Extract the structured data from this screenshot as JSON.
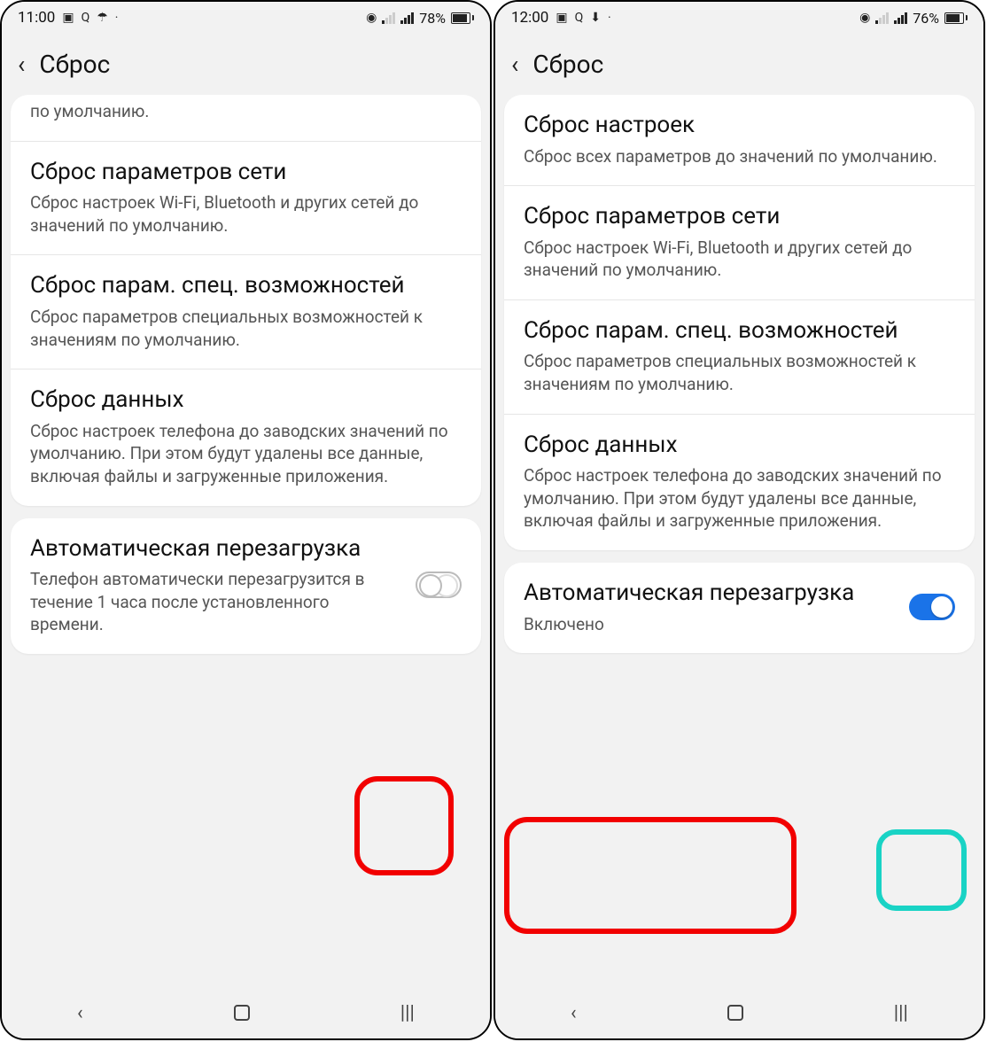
{
  "left": {
    "statusbar": {
      "time": "11:00",
      "battery": "78%"
    },
    "header": {
      "title": "Сброс"
    },
    "partial_item": {
      "desc": "по умолчанию."
    },
    "items": [
      {
        "title": "Сброс параметров сети",
        "desc": "Сброс настроек Wi-Fi, Bluetooth и других сетей до значений по умолчанию."
      },
      {
        "title": "Сброс парам. спец. возможностей",
        "desc": "Сброс параметров специальных возможностей к значениям по умолчанию."
      },
      {
        "title": "Сброс данных",
        "desc": "Сброс настроек телефона до заводских значений по умолчанию. При этом будут удалены все данные, включая файлы и загруженные приложения."
      }
    ],
    "toggle": {
      "title": "Автоматическая перезагрузка",
      "desc": "Телефон автоматически перезагрузится в течение 1 часа после установленного времени.",
      "on": false
    }
  },
  "right": {
    "statusbar": {
      "time": "12:00",
      "battery": "76%"
    },
    "header": {
      "title": "Сброс"
    },
    "items": [
      {
        "title": "Сброс настроек",
        "desc": "Сброс всех параметров до значений по умолчанию."
      },
      {
        "title": "Сброс параметров сети",
        "desc": "Сброс настроек Wi-Fi, Bluetooth и других сетей до значений по умолчанию."
      },
      {
        "title": "Сброс парам. спец. возможностей",
        "desc": "Сброс параметров специальных возможностей к значениям по умолчанию."
      },
      {
        "title": "Сброс данных",
        "desc": "Сброс настроек телефона до заводских значений по умолчанию. При этом будут удалены все данные, включая файлы и загруженные приложения."
      }
    ],
    "toggle": {
      "title": "Автоматическая перезагрузка",
      "desc": "Включено",
      "on": true
    }
  }
}
